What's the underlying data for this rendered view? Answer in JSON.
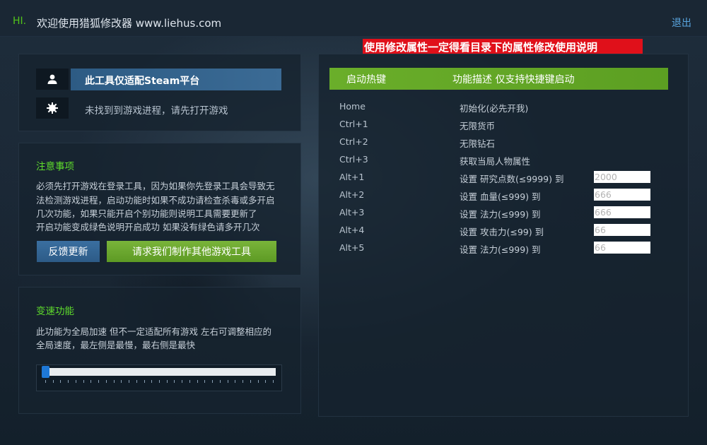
{
  "window": {
    "hi_label": "HI.",
    "title": "欢迎使用猎狐修改器 www.liehus.com",
    "exit_label": "退出"
  },
  "banner": {
    "text": "使用修改属性一定得看目录下的属性修改使用说明",
    "color": "#e0101a"
  },
  "platform": {
    "user_icon": "user-icon",
    "status_icon": "gear-icon",
    "platform_text": "此工具仅适配Steam平台",
    "status_text": "未找到到游戏进程，请先打开游戏"
  },
  "notice": {
    "title": "注意事项",
    "lines": [
      "必须先打开游戏在登录工具，因为如果你先登录工具会导致无",
      "法检测游戏进程，启动功能时如果不成功请检查杀毒或多开启",
      "几次功能，如果只能开启个别功能则说明工具需要更新了",
      "开启功能变成绿色说明开启成功 如果没有绿色请多开几次"
    ],
    "feedback_button": "反馈更新",
    "request_button": "请求我们制作其他游戏工具"
  },
  "speed": {
    "title": "变速功能",
    "lines": [
      "此功能为全局加速 但不一定适配所有游戏 左右可调整相应的",
      "全局速度，最左侧是最慢，最右侧是最快"
    ],
    "slider_value_fraction": 0.0
  },
  "hotkeys": {
    "header_key": "启动热键",
    "header_desc": "功能描述 仅支持快捷键启动",
    "rows": [
      {
        "key": "Home",
        "desc": "初始化(必先开我)",
        "input": null
      },
      {
        "key": "Ctrl+1",
        "desc": "无限货币",
        "input": null
      },
      {
        "key": "Ctrl+2",
        "desc": "无限钻石",
        "input": null
      },
      {
        "key": "Ctrl+3",
        "desc": "获取当局人物属性",
        "input": null
      },
      {
        "key": "Alt+1",
        "desc": "设置 研究点数(≤9999) 到",
        "input": "2000"
      },
      {
        "key": "Alt+2",
        "desc": "设置 血量(≤999) 到",
        "input": "666"
      },
      {
        "key": "Alt+3",
        "desc": "设置 法力(≤999) 到",
        "input": "666"
      },
      {
        "key": "Alt+4",
        "desc": "设置 攻击力(≤99) 到",
        "input": "66"
      },
      {
        "key": "Alt+5",
        "desc": "设置 法力(≤999) 到",
        "input": "66"
      }
    ]
  },
  "colors": {
    "accent_green": "#5fdc2c",
    "button_blue": "#2d5b87",
    "button_green": "#5d9a24",
    "header_green": "#6aae2a",
    "link_blue": "#5aa6e0"
  }
}
